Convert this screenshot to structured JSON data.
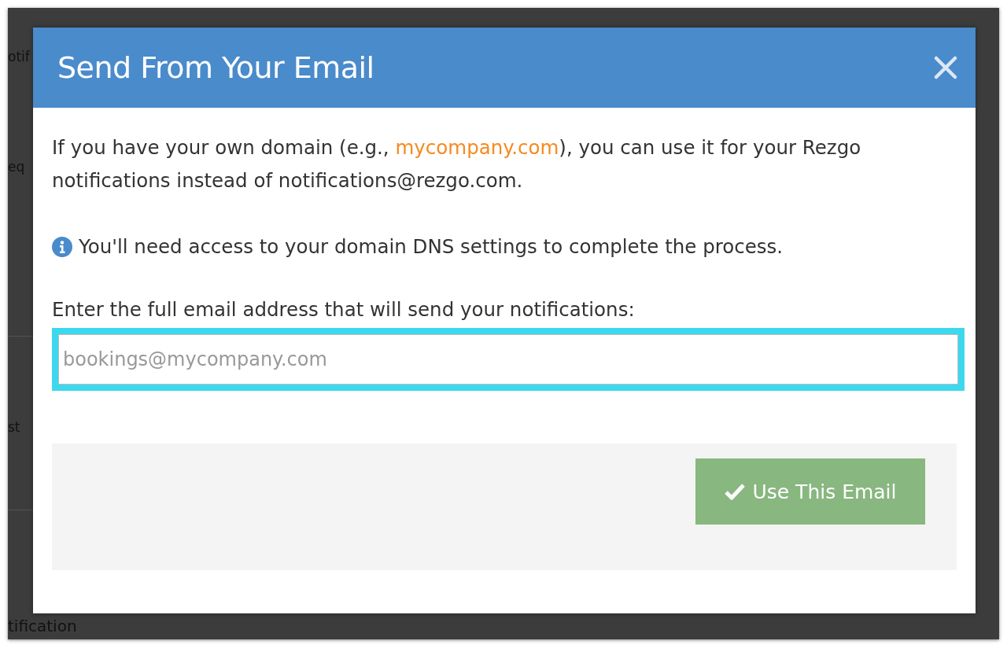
{
  "background": {
    "texts": [
      "otif",
      "eq",
      "st",
      "tification"
    ]
  },
  "dialog": {
    "title": "Send From Your Email",
    "intro": {
      "before": "If you have your own domain (e.g., ",
      "link": "mycompany.com",
      "after": "), you can use it for your Rezgo notifications instead of notifications@rezgo.com."
    },
    "note": "You'll need access to your domain DNS settings to complete the process.",
    "field_label": "Enter the full email address that will send your notifications:",
    "email_field": {
      "placeholder": "bookings@mycompany.com",
      "focused": true
    },
    "submit_button": "Use This Email"
  }
}
